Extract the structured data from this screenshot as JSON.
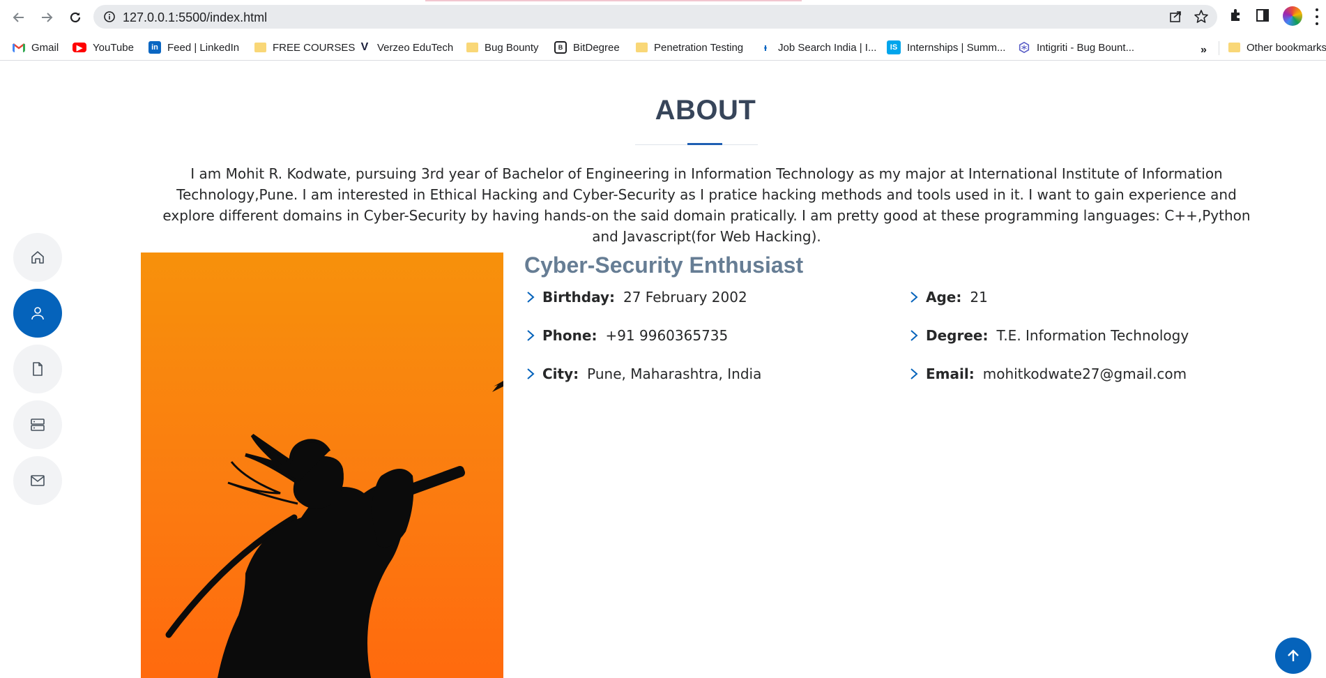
{
  "browser": {
    "url": "127.0.0.1:5500/index.html",
    "bookmarks": [
      {
        "label": "Gmail",
        "icon": "gmail-icon"
      },
      {
        "label": "YouTube",
        "icon": "youtube-icon"
      },
      {
        "label": "Feed | LinkedIn",
        "icon": "linkedin-icon"
      },
      {
        "label": "FREE COURSES",
        "icon": "folder-icon"
      },
      {
        "label": "Verzeo EduTech",
        "icon": "verzeo-icon"
      },
      {
        "label": "Bug Bounty",
        "icon": "folder-icon"
      },
      {
        "label": "BitDegree",
        "icon": "bitdegree-icon"
      },
      {
        "label": "Penetration Testing",
        "icon": "folder-icon"
      },
      {
        "label": "Job Search India | I...",
        "icon": "job-search-icon"
      },
      {
        "label": "Internships | Summ...",
        "icon": "internshala-icon"
      },
      {
        "label": "Intigriti - Bug Bount...",
        "icon": "intigriti-icon"
      }
    ],
    "more_label": "»",
    "other_bookmarks": "Other bookmarks"
  },
  "about": {
    "title": "ABOUT",
    "text": "I am Mohit R. Kodwate, pursuing 3rd year of Bachelor of Engineering in Information Technology as my major at International Institute of Information Technology,Pune. I am interested in Ethical Hacking and Cyber-Security as I pratice hacking methods and tools used in it. I want to gain experience and explore different domains in Cyber-Security by having hands-on the said domain pratically. I am pretty good at these programming languages: C++,Python and Javascript(for Web Hacking).",
    "subtitle": "Cyber-Security Enthusiast",
    "details_left": [
      {
        "label": "Birthday:",
        "value": "27 February 2002"
      },
      {
        "label": "Phone:",
        "value": "+91 9960365735"
      },
      {
        "label": "City:",
        "value": "Pune, Maharashtra, India"
      }
    ],
    "details_right": [
      {
        "label": "Age:",
        "value": "21"
      },
      {
        "label": "Degree:",
        "value": "T.E. Information Technology"
      },
      {
        "label": "Email:",
        "value": "mohitkodwate27@gmail.com"
      }
    ]
  },
  "side_nav": [
    "home-icon",
    "person-icon",
    "file-icon",
    "server-icon",
    "envelope-icon"
  ],
  "colors": {
    "accent": "#0563bb",
    "heading": "#37455a",
    "subtitle": "#667d94",
    "photo_top": "#f7910b",
    "photo_bottom": "#ff6a0e"
  }
}
